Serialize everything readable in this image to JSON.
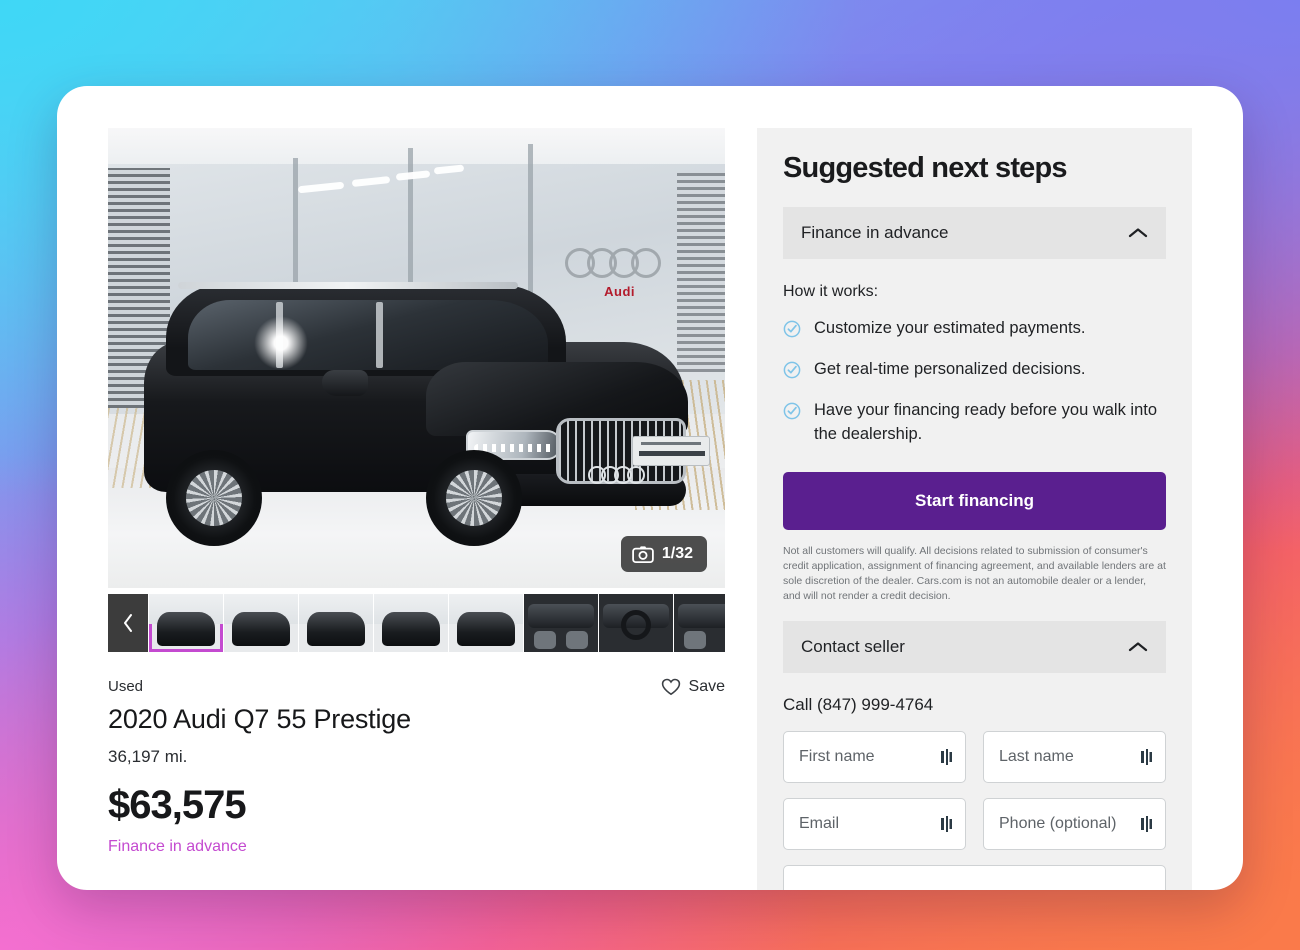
{
  "gallery": {
    "photo_counter": "1/32",
    "camera_icon": "camera-icon",
    "prev_label": "‹",
    "next_label": "›",
    "thumbnails": [
      {
        "name": "thumb-front-quarter",
        "selected": true,
        "kind": "exterior"
      },
      {
        "name": "thumb-side-profile",
        "selected": false,
        "kind": "exterior"
      },
      {
        "name": "thumb-rear",
        "selected": false,
        "kind": "exterior"
      },
      {
        "name": "thumb-rear-quarter",
        "selected": false,
        "kind": "exterior"
      },
      {
        "name": "thumb-front",
        "selected": false,
        "kind": "exterior"
      },
      {
        "name": "thumb-interior-console",
        "selected": false,
        "kind": "interior"
      },
      {
        "name": "thumb-interior-dashboard",
        "selected": false,
        "kind": "interior"
      },
      {
        "name": "thumb-interior-seats",
        "selected": false,
        "kind": "interior"
      }
    ]
  },
  "vehicle": {
    "condition": "Used",
    "title": "2020 Audi Q7 55 Prestige",
    "mileage": "36,197 mi.",
    "price": "$63,575",
    "finance_link": "Finance in advance",
    "save_label": "Save",
    "save_icon": "heart-icon"
  },
  "sidebar": {
    "title": "Suggested next steps",
    "finance_section": {
      "label": "Finance in advance",
      "chevron_icon": "chevron-up-icon",
      "how_label": "How it works:",
      "bullets": [
        "Customize your estimated payments.",
        "Get real-time personalized decisions.",
        "Have your financing ready before you walk into the dealership."
      ],
      "cta_label": "Start financing",
      "disclaimer": "Not all customers will qualify. All decisions related to submission of consumer's credit application, assignment of financing agreement, and available lenders are at sole discretion of the dealer. Cars.com is not an automobile dealer or a lender, and will not render a credit decision."
    },
    "contact_section": {
      "label": "Contact seller",
      "chevron_icon": "chevron-up-icon",
      "call_line": "Call (847) 999-4764",
      "fields": [
        {
          "name": "first-name-field",
          "placeholder": "First name",
          "value": "",
          "wide": false
        },
        {
          "name": "last-name-field",
          "placeholder": "Last name",
          "value": "",
          "wide": false
        },
        {
          "name": "email-field",
          "placeholder": "Email",
          "value": "",
          "wide": false
        },
        {
          "name": "phone-field",
          "placeholder": "Phone (optional)",
          "value": "",
          "wide": false
        },
        {
          "name": "message-field",
          "placeholder": "",
          "value": "",
          "wide": true
        }
      ]
    }
  },
  "colors": {
    "accent_purple": "#5a1f8f",
    "accent_magenta": "#c44ad0",
    "check_blue": "#7fc4e8",
    "panel_bg": "#f1f1f1",
    "accordion_bg": "#e4e4e4",
    "card_bg": "#ffffff"
  }
}
